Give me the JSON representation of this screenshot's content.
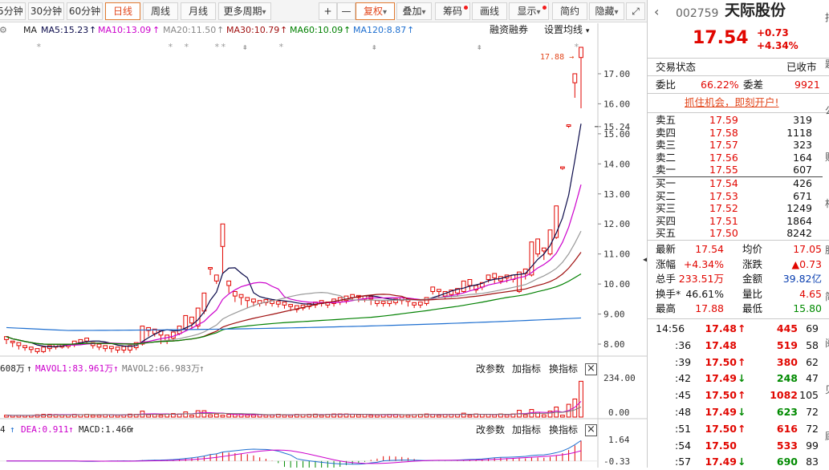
{
  "toolbar": {
    "m5": "5分钟",
    "m30": "30分钟",
    "m60": "60分钟",
    "day": "日线",
    "week": "周线",
    "month": "月线",
    "more": "更多周期",
    "more_arrow": "▾",
    "plus": "+",
    "minus": "—",
    "fuquan": "复权",
    "fq_arrow": "▾",
    "diejia": "叠加",
    "dj_arrow": "▾",
    "chouma": "筹码",
    "huaxian": "画线",
    "xianshi": "显示",
    "xs_arrow": "▾",
    "jianyue": "简约",
    "yincang": "隐藏",
    "yc_arrow": "▾",
    "expand": "⤢"
  },
  "chart": {
    "ma_title": "MA",
    "ma5": "MA5:15.23",
    "ma10": "MA10:13.09",
    "ma20": "MA20:11.50",
    "ma30": "MA30:10.79",
    "ma60": "MA60:10.09",
    "ma120": "MA120:8.87",
    "rzrq": "融资融券",
    "set_ma": "设置均线",
    "set_arrow": "▾",
    "high_label": "17.88",
    "price_ticks": [
      "17.00",
      "16.00",
      "15.24",
      "15.00",
      "14.00",
      "13.00",
      "12.00",
      "11.00",
      "10.00",
      "9.00",
      "8.00"
    ],
    "vol_label": "608万",
    "mavol1": "MAVOL1:83.961万",
    "mavol2": "MAVOL2:66.983万",
    "vol_ticks": [
      "234.00",
      "0.00"
    ],
    "macd_lead": "4",
    "dea": "DEA:0.911",
    "macd": "MACD:1.466",
    "macd_ticks": [
      "1.64",
      "-0.33"
    ],
    "param": "改参数",
    "add_ind": "加指标",
    "switch_ind": "换指标",
    "close": "×"
  },
  "chart_data": {
    "type": "candlestick",
    "candles": [
      [
        8.15,
        8.25,
        8.05,
        8.0
      ],
      [
        8.05,
        8.1,
        7.92,
        7.9
      ],
      [
        7.95,
        8.05,
        7.85,
        7.82
      ],
      [
        7.88,
        7.95,
        7.8,
        7.78
      ],
      [
        7.82,
        7.9,
        7.72,
        7.7
      ],
      [
        7.75,
        7.85,
        7.78,
        7.68
      ],
      [
        7.75,
        7.9,
        7.85,
        7.7
      ],
      [
        7.85,
        7.95,
        7.9,
        7.75
      ],
      [
        7.9,
        8.0,
        7.95,
        7.82
      ],
      [
        7.9,
        7.98,
        7.92,
        7.85
      ],
      [
        7.92,
        8.0,
        7.96,
        7.85
      ],
      [
        7.98,
        8.1,
        8.05,
        7.9
      ],
      [
        8.05,
        8.15,
        8.1,
        7.98
      ],
      [
        8.1,
        8.2,
        8.15,
        8.0
      ],
      [
        7.95,
        8.05,
        7.9,
        7.85
      ],
      [
        7.9,
        8.0,
        7.85,
        7.8
      ],
      [
        7.85,
        7.95,
        7.88,
        7.75
      ],
      [
        7.85,
        7.92,
        7.82,
        7.72
      ],
      [
        7.8,
        7.9,
        7.75,
        7.7
      ],
      [
        7.8,
        7.92,
        7.78,
        7.7
      ],
      [
        7.8,
        7.95,
        7.88,
        7.7
      ],
      [
        7.88,
        8.05,
        7.95,
        7.8
      ],
      [
        8.0,
        8.6,
        8.5,
        7.95
      ],
      [
        8.45,
        8.55,
        8.35,
        8.25
      ],
      [
        8.35,
        8.5,
        8.4,
        8.25
      ],
      [
        8.3,
        8.45,
        8.05,
        8.0
      ],
      [
        8.1,
        8.3,
        8.2,
        8.0
      ],
      [
        8.2,
        8.4,
        8.35,
        8.1
      ],
      [
        8.35,
        8.6,
        8.5,
        8.3
      ],
      [
        8.5,
        8.95,
        8.9,
        8.45
      ],
      [
        8.7,
        8.9,
        8.55,
        8.5
      ],
      [
        8.6,
        9.2,
        9.1,
        8.5
      ],
      [
        9.1,
        9.7,
        9.6,
        9.0
      ],
      [
        10.5,
        10.55,
        10.4,
        10.3
      ],
      [
        10.1,
        10.3,
        10.2,
        10.0
      ],
      [
        11.25,
        12.0,
        10.4,
        10.35
      ],
      [
        9.95,
        10.1,
        9.85,
        9.7
      ],
      [
        9.6,
        9.75,
        9.55,
        9.4
      ],
      [
        9.55,
        9.65,
        9.45,
        9.3
      ],
      [
        9.45,
        9.55,
        9.28,
        9.2
      ],
      [
        9.4,
        9.5,
        9.33,
        9.25
      ],
      [
        9.35,
        9.45,
        9.4,
        9.25
      ],
      [
        9.38,
        9.48,
        9.35,
        9.28
      ],
      [
        9.35,
        9.45,
        9.32,
        9.25
      ],
      [
        9.33,
        9.42,
        9.38,
        9.22
      ],
      [
        9.3,
        9.4,
        9.25,
        9.18
      ],
      [
        9.25,
        9.32,
        9.15,
        9.1
      ],
      [
        9.15,
        9.28,
        9.2,
        9.05
      ],
      [
        9.2,
        9.3,
        9.25,
        9.12
      ],
      [
        9.25,
        9.35,
        9.3,
        9.15
      ],
      [
        9.3,
        9.4,
        9.38,
        9.2
      ],
      [
        9.35,
        9.45,
        9.3,
        9.25
      ],
      [
        9.3,
        9.4,
        9.35,
        9.2
      ],
      [
        9.35,
        9.5,
        9.45,
        9.25
      ],
      [
        9.4,
        9.55,
        9.5,
        9.3
      ],
      [
        9.45,
        9.6,
        9.55,
        9.35
      ],
      [
        9.55,
        9.65,
        9.6,
        9.45
      ],
      [
        9.55,
        9.62,
        9.5,
        9.4
      ],
      [
        9.5,
        9.6,
        9.55,
        9.4
      ],
      [
        9.5,
        9.58,
        9.35,
        9.3
      ],
      [
        9.35,
        9.45,
        9.32,
        9.25
      ],
      [
        9.35,
        9.42,
        9.38,
        9.25
      ],
      [
        9.35,
        9.45,
        9.4,
        9.25
      ],
      [
        9.38,
        9.5,
        9.45,
        9.3
      ],
      [
        9.45,
        9.55,
        9.42,
        9.32
      ],
      [
        9.42,
        9.5,
        9.3,
        9.25
      ],
      [
        9.3,
        9.38,
        9.33,
        9.2
      ],
      [
        9.3,
        9.4,
        9.35,
        9.2
      ],
      [
        9.35,
        9.55,
        9.48,
        9.28
      ],
      [
        9.75,
        9.9,
        9.8,
        9.65
      ],
      [
        9.75,
        9.82,
        9.6,
        9.55
      ],
      [
        9.6,
        9.75,
        9.65,
        9.5
      ],
      [
        9.65,
        9.8,
        9.7,
        9.55
      ],
      [
        9.7,
        9.85,
        9.75,
        9.6
      ],
      [
        9.75,
        10.1,
        10.0,
        9.7
      ],
      [
        9.95,
        10.15,
        9.85,
        9.8
      ],
      [
        9.8,
        9.95,
        9.9,
        9.7
      ],
      [
        9.9,
        10.05,
        9.95,
        9.8
      ],
      [
        10.15,
        10.3,
        10.2,
        10.05
      ],
      [
        10.2,
        10.35,
        10.1,
        10.0
      ],
      [
        10.1,
        10.25,
        10.2,
        10.0
      ],
      [
        10.2,
        10.3,
        10.15,
        10.05
      ],
      [
        10.15,
        10.3,
        10.25,
        10.05
      ],
      [
        9.75,
        10.4,
        10.35,
        9.7
      ],
      [
        10.35,
        10.5,
        10.25,
        10.15
      ],
      [
        10.3,
        11.4,
        11.0,
        10.25
      ],
      [
        11.0,
        11.5,
        11.3,
        10.9
      ],
      [
        11.1,
        11.2,
        10.9,
        10.8
      ],
      [
        11.0,
        11.8,
        11.5,
        10.95
      ],
      [
        11.55,
        12.6,
        12.55,
        11.5
      ],
      [
        13.85,
        13.9,
        13.85,
        13.8
      ],
      [
        15.25,
        15.3,
        15.25,
        15.2
      ],
      [
        16.7,
        17.0,
        16.9,
        16.2
      ],
      [
        17.54,
        17.88,
        16.05,
        15.85
      ]
    ],
    "ylim": [
      7.6,
      18.2
    ],
    "ma5": "15.23",
    "ma10": "13.09",
    "ma20": "11.50",
    "ma30": "10.79",
    "ma60": "10.09",
    "ma120": "8.87",
    "volume_ylim": [
      0,
      234
    ],
    "macd_ylim": [
      -0.33,
      1.64
    ]
  },
  "colors": {
    "up": "#e10600",
    "down": "#008a00",
    "ma5": "#0a0a4a",
    "ma10": "#cc00cc",
    "ma20": "#999999",
    "ma30": "#a01010",
    "ma60": "#008000",
    "ma120": "#1e6fd0",
    "accent": "#e2461b"
  },
  "quote": {
    "code": "002759",
    "name": "天际股份",
    "price": "17.54",
    "chg": "+0.73",
    "pct": "+4.34%",
    "status_label": "交易状态",
    "status_val": "已收市",
    "weibi_label": "委比",
    "weibi_val": "66.22%",
    "weicha_label": "委差",
    "weicha_val": "9921",
    "promo": "抓住机会，即刻开户!",
    "sells": [
      {
        "label": "卖五",
        "price": "17.59",
        "vol": "319"
      },
      {
        "label": "卖四",
        "price": "17.58",
        "vol": "1118"
      },
      {
        "label": "卖三",
        "price": "17.57",
        "vol": "323"
      },
      {
        "label": "卖二",
        "price": "17.56",
        "vol": "164"
      },
      {
        "label": "卖一",
        "price": "17.55",
        "vol": "607"
      }
    ],
    "buys": [
      {
        "label": "买一",
        "price": "17.54",
        "vol": "426"
      },
      {
        "label": "买二",
        "price": "17.53",
        "vol": "671"
      },
      {
        "label": "买三",
        "price": "17.52",
        "vol": "1249"
      },
      {
        "label": "买四",
        "price": "17.51",
        "vol": "1864"
      },
      {
        "label": "买五",
        "price": "17.50",
        "vol": "8242"
      }
    ],
    "stats": [
      {
        "l1": "最新",
        "v1": "17.54",
        "l2": "均价",
        "v2": "17.05"
      },
      {
        "l1": "涨幅",
        "v1": "+4.34%",
        "l2": "涨跌",
        "v2": "▲0.73"
      },
      {
        "l1": "总手",
        "v1": "233.51万",
        "l2": "金额",
        "v2": "39.82亿"
      },
      {
        "l1": "换手*",
        "v1": "46.61%",
        "l2": "量比",
        "v2": "4.65"
      },
      {
        "l1": "最高",
        "v1": "17.88",
        "l2": "最低",
        "v2": "15.80"
      }
    ],
    "ticks": [
      {
        "t": "14:56",
        "p": "17.48",
        "a": "↑",
        "v": "445",
        "n": "69"
      },
      {
        "t": ":36",
        "p": "17.48",
        "a": "",
        "v": "519",
        "n": "58"
      },
      {
        "t": ":39",
        "p": "17.50",
        "a": "↑",
        "v": "380",
        "n": "62"
      },
      {
        "t": ":42",
        "p": "17.49",
        "a": "↓",
        "v": "248",
        "n": "47"
      },
      {
        "t": ":45",
        "p": "17.50",
        "a": "↑",
        "v": "1082",
        "n": "105"
      },
      {
        "t": ":48",
        "p": "17.49",
        "a": "↓",
        "v": "623",
        "n": "72"
      },
      {
        "t": ":51",
        "p": "17.50",
        "a": "↑",
        "v": "616",
        "n": "72"
      },
      {
        "t": ":54",
        "p": "17.50",
        "a": "",
        "v": "533",
        "n": "99"
      },
      {
        "t": ":57",
        "p": "17.49",
        "a": "↓",
        "v": "690",
        "n": "83"
      }
    ],
    "left_arrow": "‹",
    "collapse": "‹",
    "edge_chars": [
      "报",
      "题",
      "公",
      "财",
      "相",
      "股",
      "简",
      "阅",
      "见",
      "顾"
    ]
  }
}
